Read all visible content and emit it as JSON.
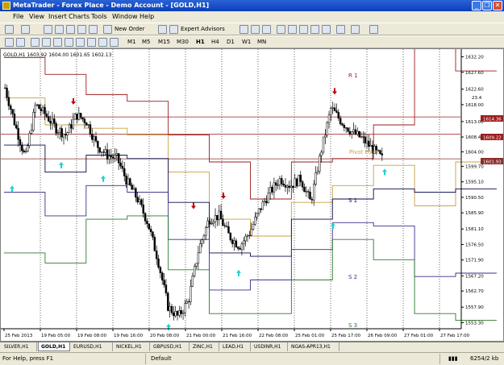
{
  "window": {
    "title": "MetaTrader - Forex Place - Demo Account - [GOLD,H1]",
    "minimize": "_",
    "restore": "❐",
    "close": "✕"
  },
  "menu": [
    "File",
    "View",
    "Insert",
    "Charts",
    "Tools",
    "Window",
    "Help"
  ],
  "toolbar": {
    "new_order": "New Order",
    "expert_advisors": "Expert Advisors",
    "timeframes": [
      "M1",
      "M5",
      "M15",
      "M30",
      "H1",
      "H4",
      "D1",
      "W1",
      "MN"
    ]
  },
  "chart": {
    "header": "GOLD,H1  1603.92 1604.00 1601.65 1602.13",
    "corner_value": "23.4",
    "price_tag_upper": "1614.36",
    "price_tag_mid": "1609.22",
    "price_tag_current": "1601.93",
    "level_labels": {
      "r1": "R 1",
      "pivot": "Pivot Point",
      "s1": "S 1",
      "s2": "S 2",
      "s3": "S 3"
    },
    "colors": {
      "background": "#ffffff",
      "r1": "#9c1d1d",
      "pivot": "#c8a040",
      "s1": "#0b0b4a",
      "s2": "#3c2f8a",
      "s3": "#2b7a2b",
      "up_arrow": "#1fd1d1",
      "down_arrow": "#c00000"
    }
  },
  "chart_data": {
    "type": "candlestick",
    "symbol": "GOLD",
    "timeframe": "H1",
    "ylim": [
      1551.5,
      1634.0
    ],
    "yticks": [
      1632.2,
      1627.6,
      1622.6,
      1618.0,
      1613.0,
      1608.4,
      1604.0,
      1599.7,
      1595.1,
      1590.5,
      1585.9,
      1581.1,
      1576.5,
      1571.9,
      1567.2,
      1562.7,
      1557.9,
      1553.3
    ],
    "xticks": [
      "25 Feb 2013",
      "19 Feb 05:00",
      "19 Feb 08:00",
      "19 Feb 16:00",
      "20 Feb 08:00",
      "21 Feb 00:00",
      "21 Feb 16:00",
      "22 Feb 08:00",
      "25 Feb 01:00",
      "25 Feb 17:00",
      "26 Feb 09:00",
      "27 Feb 01:00",
      "27 Feb 17:00"
    ],
    "current_price": 1601.93,
    "close_path": [
      1623,
      1612,
      1602,
      1618,
      1615,
      1611,
      1609,
      1615,
      1613,
      1606,
      1603,
      1602,
      1595,
      1590,
      1583,
      1572,
      1558,
      1555,
      1560,
      1575,
      1584,
      1585,
      1579,
      1576,
      1580,
      1587,
      1592,
      1596,
      1594,
      1596,
      1589,
      1604,
      1617,
      1613,
      1610,
      1608,
      1605,
      1602
    ]
  },
  "tabs": [
    "SILVER,H1",
    "GOLD,H1",
    "EURUSD,H1",
    "NICKEL,H1",
    "GBPUSD,H1",
    "ZINC,H1",
    "LEAD,H1",
    "USDINR,H1",
    "NGAS-APR13,H1"
  ],
  "status": {
    "help": "For Help, press F1",
    "profile": "Default",
    "traffic": "6254/2 kb"
  }
}
